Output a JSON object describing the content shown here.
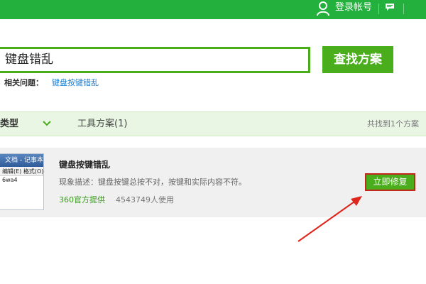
{
  "header": {
    "login_label": "登录帐号",
    "icons": [
      "user-icon",
      "chat-icon"
    ],
    "bg_color": "#23b03c"
  },
  "search": {
    "value": "键盘错乱",
    "button_label": "查找方案",
    "related_label": "相关问题：",
    "related_link": "键盘按键错乱",
    "accent_color": "#4aad1c"
  },
  "tabs": {
    "type_label": "问题类型",
    "tools_label": "工具方案(1)",
    "found_text": "共找到1个方案"
  },
  "result": {
    "thumbnail": {
      "title": "文档 - 记事本",
      "menu": "编辑(E)  格式(O)",
      "text": "6wa4"
    },
    "title": "键盘按键错乱",
    "description": "现象描述：键盘按键总按不对，按键和实际内容不符。",
    "source": "360官方提供",
    "users": "4543749人使用",
    "fix_button": "立即修复"
  },
  "annotation": {
    "arrow_color": "#e0251b"
  }
}
